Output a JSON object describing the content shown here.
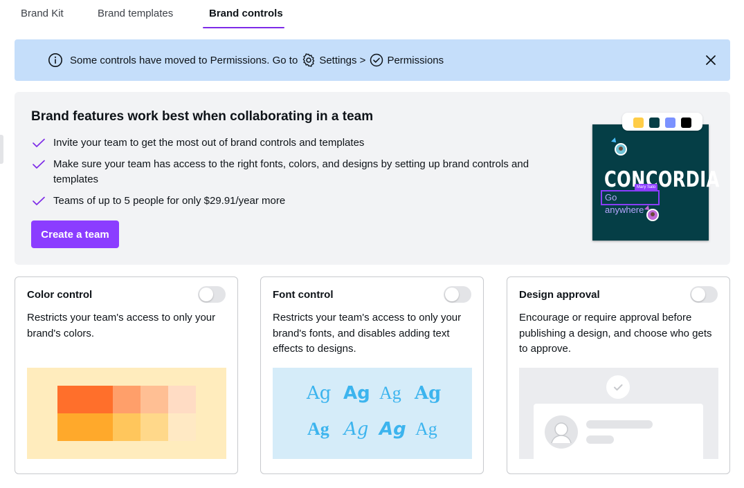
{
  "tabs": [
    {
      "label": "Brand Kit"
    },
    {
      "label": "Brand templates"
    },
    {
      "label": "Brand controls",
      "active": true
    }
  ],
  "notice": {
    "text_before": "Some controls have moved to Permissions. Go to",
    "settings_label": "Settings >",
    "permissions_label": "Permissions",
    "bg_color": "#c5defa"
  },
  "promo": {
    "title": "Brand features work best when collaborating in a team",
    "bullets": [
      "Invite your team to get the most out of brand controls and templates",
      "Make sure your team has access to the right fonts, colors, and designs by setting up brand controls and templates",
      "Teams of up to 5 people for only $29.91/year more"
    ],
    "cta_label": "Create a team",
    "cta_color": "#8b3dff",
    "illustration": {
      "brand_word": "CONCORDIA",
      "tagline": "Go anywhere",
      "collaborator_name": "Mary Sato",
      "swatches": [
        "#ffcd47",
        "#053e46",
        "#7b92ff",
        "#000000"
      ]
    }
  },
  "cards": [
    {
      "title": "Color control",
      "description": "Restricts your team's access to only your brand's colors.",
      "enabled": false
    },
    {
      "title": "Font control",
      "description": "Restricts your team's access to only your brand's fonts, and disables adding text effects to designs.",
      "enabled": false,
      "sample_glyph": "Ag"
    },
    {
      "title": "Design approval",
      "description": "Encourage or require approval before publishing a design, and choose who gets to approve.",
      "enabled": false
    }
  ],
  "color_swatches": [
    "#ff6f2b",
    "#ff9f6a",
    "#ffbf94",
    "#ffdcc4",
    "#ffa92b",
    "#ffc65c",
    "#ffd88a",
    "#ffe9c4"
  ]
}
